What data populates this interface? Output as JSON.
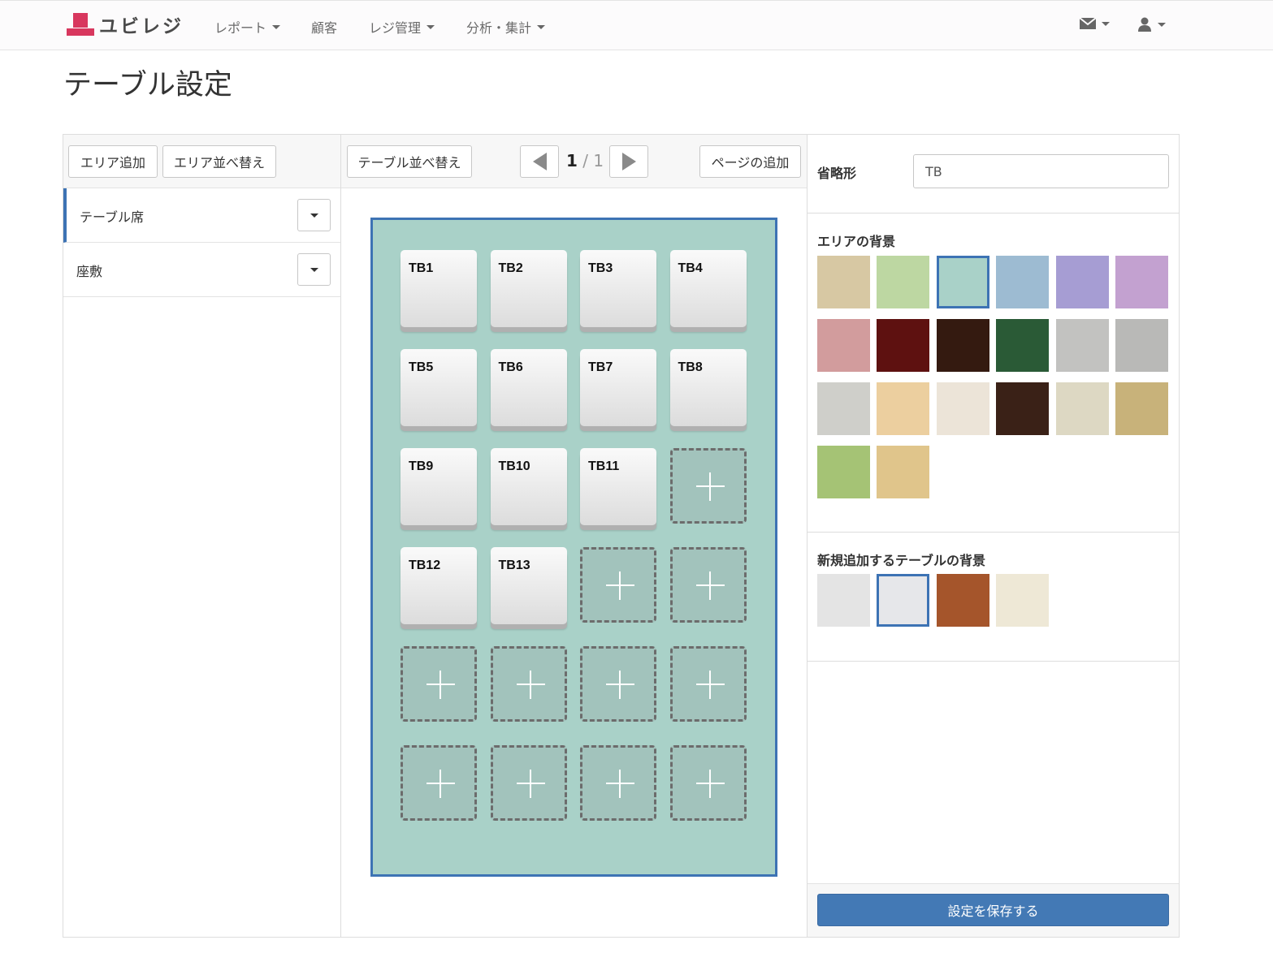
{
  "app": {
    "brand": "ユビレジ"
  },
  "nav": {
    "items": [
      {
        "label": "レポート",
        "dropdown": true
      },
      {
        "label": "顧客",
        "dropdown": false
      },
      {
        "label": "レジ管理",
        "dropdown": true
      },
      {
        "label": "分析・集計",
        "dropdown": true
      }
    ],
    "mail_icon": "envelope-icon",
    "user_icon": "user-icon"
  },
  "page": {
    "title": "テーブル設定"
  },
  "left": {
    "add_area_label": "エリア追加",
    "sort_area_label": "エリア並べ替え",
    "areas": [
      {
        "label": "テーブル席",
        "active": true
      },
      {
        "label": "座敷",
        "active": false
      }
    ]
  },
  "middle": {
    "sort_tables_label": "テーブル並べ替え",
    "pager": {
      "current": "1",
      "separator": " / ",
      "total": "1"
    },
    "add_page_label": "ページの追加",
    "floor_color": "#a9d1c8",
    "grid": {
      "columns": 4,
      "rows": 6,
      "tables": [
        "TB1",
        "TB2",
        "TB3",
        "TB4",
        "TB5",
        "TB6",
        "TB7",
        "TB8",
        "TB9",
        "TB10",
        "TB11",
        "",
        "TB12",
        "TB13",
        "",
        "",
        "",
        "",
        "",
        "",
        "",
        "",
        "",
        ""
      ]
    }
  },
  "right": {
    "abbr_label": "省略形",
    "abbr_value": "TB",
    "area_bg_label": "エリアの背景",
    "area_bg_swatches": [
      {
        "name": "beige",
        "color": "#d7c8a3"
      },
      {
        "name": "light-green",
        "color": "#bdd7a2"
      },
      {
        "name": "mint",
        "color": "#a9d1c8",
        "selected": true
      },
      {
        "name": "light-blue",
        "color": "#9dbbd2"
      },
      {
        "name": "lavender",
        "color": "#a69dd3"
      },
      {
        "name": "lilac",
        "color": "#c3a1d0"
      },
      {
        "name": "dusty-pink",
        "color": "#d29c9d"
      },
      {
        "name": "dark-red",
        "color": "#5e1110"
      },
      {
        "name": "dark-brown",
        "color": "#341a10"
      },
      {
        "name": "dark-green",
        "color": "#2a5a36"
      },
      {
        "name": "concrete-1",
        "color": "#c2c2c0"
      },
      {
        "name": "concrete-2",
        "color": "#b9b9b7"
      },
      {
        "name": "marble",
        "color": "#cfcfca"
      },
      {
        "name": "light-wood",
        "color": "#eccf9f"
      },
      {
        "name": "white-wood",
        "color": "#ece4d8"
      },
      {
        "name": "dark-wood",
        "color": "#3a2117"
      },
      {
        "name": "speckled-cream",
        "color": "#ddd8c3"
      },
      {
        "name": "golden-texture",
        "color": "#c8b27a"
      },
      {
        "name": "tatami-green",
        "color": "#a5c375"
      },
      {
        "name": "tatami-straw",
        "color": "#e0c58b"
      }
    ],
    "table_bg_label": "新規追加するテーブルの背景",
    "table_bg_swatches": [
      {
        "name": "white-glossy",
        "color": "#e4e4e4"
      },
      {
        "name": "light-gray",
        "color": "#e6e7ea",
        "selected": true
      },
      {
        "name": "wood",
        "color": "#a5552b"
      },
      {
        "name": "speckled",
        "color": "#eee8d6"
      }
    ],
    "save_label": "設定を保存する"
  }
}
